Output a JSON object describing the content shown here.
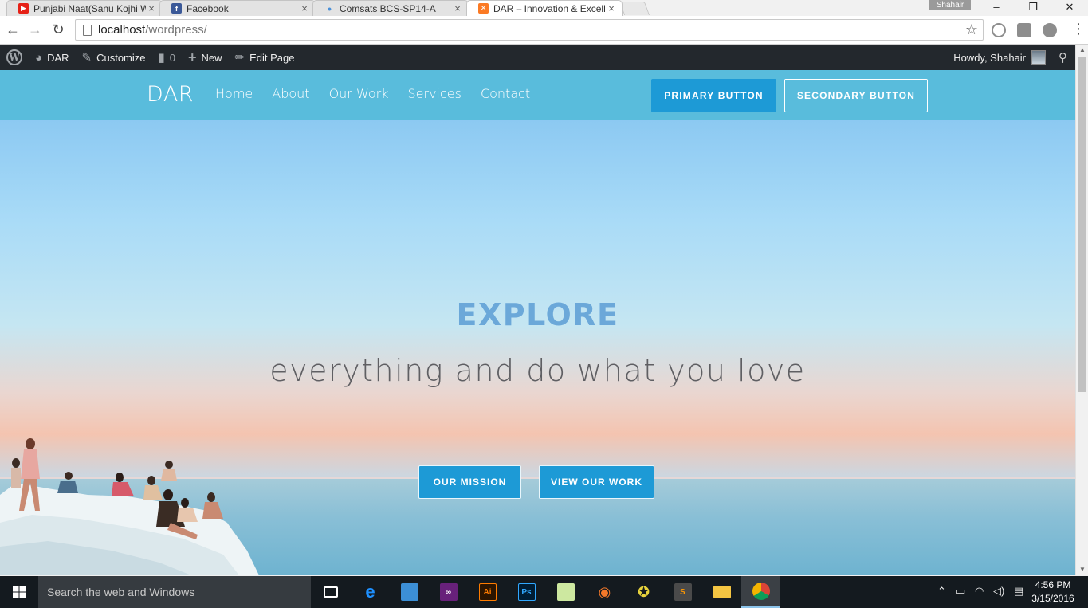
{
  "browser": {
    "tabs": [
      {
        "title": "Punjabi Naat(Sanu Kojhi W",
        "favicon": "youtube-icon"
      },
      {
        "title": "Facebook",
        "favicon": "facebook-icon"
      },
      {
        "title": "Comsats BCS-SP14-A",
        "favicon": "dot-icon"
      },
      {
        "title": "DAR – Innovation & Excell",
        "favicon": "xampp-icon",
        "active": true
      }
    ],
    "close_glyph": "×",
    "profile_name": "Shahair",
    "url_host": "localhost",
    "url_path": "/wordpress/",
    "window_controls": [
      "–",
      "❐",
      "✕"
    ]
  },
  "adminbar": {
    "site": "DAR",
    "customize": "Customize",
    "comments_count": "0",
    "new": "New",
    "edit_page": "Edit Page",
    "howdy": "Howdy, Shahair"
  },
  "site": {
    "logo": "DAR",
    "nav": [
      "Home",
      "About",
      "Our Work",
      "Services",
      "Contact"
    ],
    "primary_button": "PRIMARY BUTTON",
    "secondary_button": "SECONDARY BUTTON"
  },
  "hero": {
    "title": "EXPLORE",
    "subtitle": "everything and do what you love",
    "mission_button": "OUR MISSION",
    "work_button": "VIEW OUR WORK"
  },
  "taskbar": {
    "search_placeholder": "Search the web and Windows",
    "time": "4:56 PM",
    "date": "3/15/2016"
  },
  "colors": {
    "admin_bar": "#23282d",
    "header": "#59bcdc",
    "button": "#1d9ad6",
    "hero_title": "#6ba8d9"
  }
}
